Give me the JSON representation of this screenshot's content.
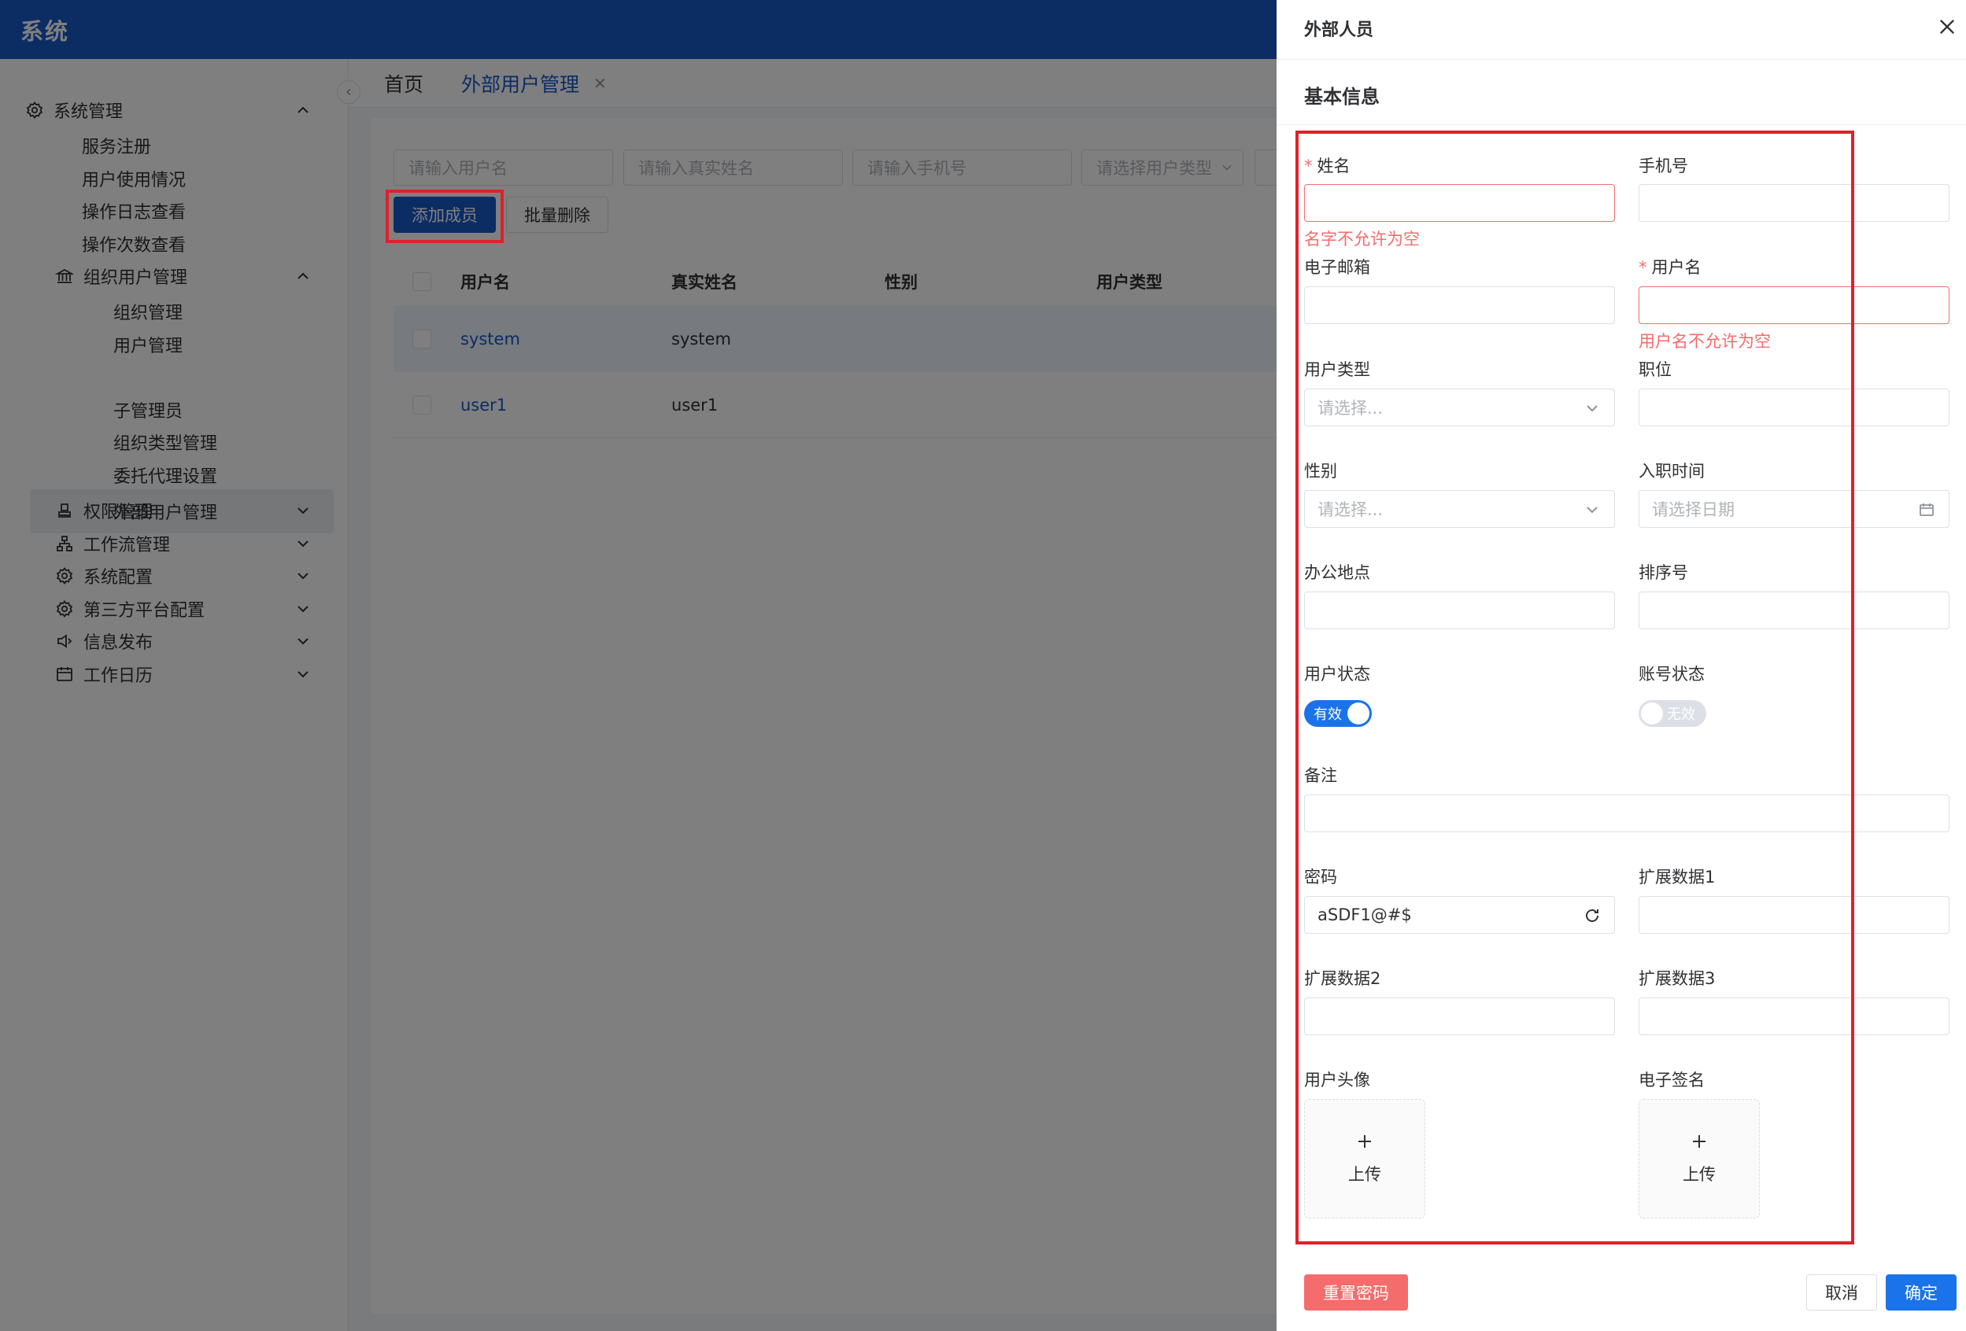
{
  "header": {
    "title": "系统"
  },
  "sidebar": {
    "items": [
      {
        "label": "系统管理",
        "icon": "gear-icon",
        "expanded": true
      },
      {
        "label": "服务注册"
      },
      {
        "label": "用户使用情况"
      },
      {
        "label": "操作日志查看"
      },
      {
        "label": "操作次数查看"
      },
      {
        "label": "组织用户管理",
        "icon": "bank-icon",
        "expanded": true
      },
      {
        "label": "组织管理"
      },
      {
        "label": "用户管理"
      },
      {
        "label": "外部用户管理",
        "active": true
      },
      {
        "label": "子管理员"
      },
      {
        "label": "组织类型管理"
      },
      {
        "label": "委托代理设置"
      },
      {
        "label": "权限管理",
        "icon": "stamp-icon"
      },
      {
        "label": "工作流管理",
        "icon": "hierarchy-icon"
      },
      {
        "label": "系统配置",
        "icon": "gear-icon"
      },
      {
        "label": "第三方平台配置",
        "icon": "gear-icon"
      },
      {
        "label": "信息发布",
        "icon": "speaker-icon"
      },
      {
        "label": "工作日历",
        "icon": "calendar-icon"
      }
    ]
  },
  "tabs": [
    {
      "label": "首页"
    },
    {
      "label": "外部用户管理",
      "active": true,
      "close": "✕"
    }
  ],
  "filters": {
    "username": "请输入用户名",
    "realname": "请输入真实姓名",
    "phone": "请输入手机号",
    "usertype": "请选择用户类型"
  },
  "toolbar": {
    "add": "添加成员",
    "batch_delete": "批量删除"
  },
  "table": {
    "headers": [
      "用户名",
      "真实姓名",
      "性别",
      "用户类型"
    ],
    "rows": [
      {
        "username": "system",
        "realname": "system"
      },
      {
        "username": "user1",
        "realname": "user1"
      }
    ]
  },
  "drawer": {
    "title": "外部人员",
    "section": "基本信息",
    "fields": {
      "name_label": "姓名",
      "name_error": "名字不允许为空",
      "phone_label": "手机号",
      "email_label": "电子邮箱",
      "username_label": "用户名",
      "username_error": "用户名不允许为空",
      "usertype_label": "用户类型",
      "usertype_placeholder": "请选择...",
      "position_label": "职位",
      "gender_label": "性别",
      "gender_placeholder": "请选择...",
      "hiredate_label": "入职时间",
      "hiredate_placeholder": "请选择日期",
      "office_label": "办公地点",
      "sort_label": "排序号",
      "userstatus_label": "用户状态",
      "userstatus_value": "有效",
      "accountstatus_label": "账号状态",
      "accountstatus_value": "无效",
      "remark_label": "备注",
      "password_label": "密码",
      "password_value": "aSDF1@#$",
      "ext1_label": "扩展数据1",
      "ext2_label": "扩展数据2",
      "ext3_label": "扩展数据3",
      "avatar_label": "用户头像",
      "signature_label": "电子签名",
      "upload_text": "上传",
      "required_mark": "*"
    },
    "footer": {
      "reset_password": "重置密码",
      "cancel": "取消",
      "confirm": "确定"
    }
  },
  "colors": {
    "primary": "#1958c8",
    "danger": "#f56c6c",
    "switch_on": "#1a73e8",
    "switch_off": "#dcdfe6"
  }
}
